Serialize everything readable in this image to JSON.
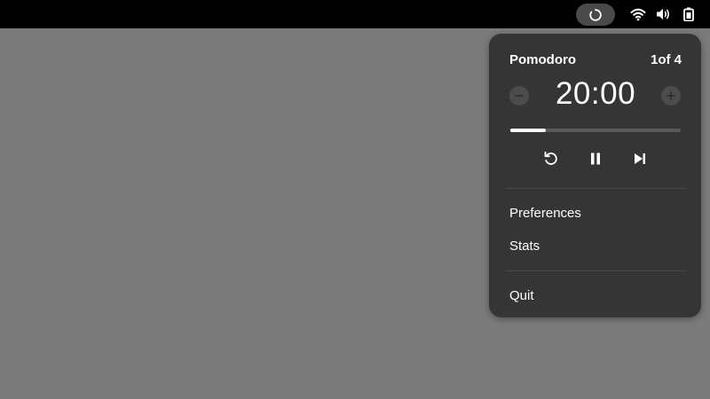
{
  "colors": {
    "desktop": "#7b7b7b",
    "topbar": "#000000",
    "popup_bg": "#353535",
    "accent": "#ffffff"
  },
  "topbar": {
    "tray_icons": [
      "timer-indicator-icon",
      "wifi-icon",
      "volume-icon",
      "battery-icon"
    ]
  },
  "popup": {
    "title": "Pomodoro",
    "count": "1of 4",
    "timer": "20:00",
    "progress": 0.21,
    "controls": [
      "restart-icon",
      "pause-icon",
      "skip-icon"
    ],
    "menu": {
      "preferences": "Preferences",
      "stats": "Stats",
      "quit": "Quit"
    }
  }
}
